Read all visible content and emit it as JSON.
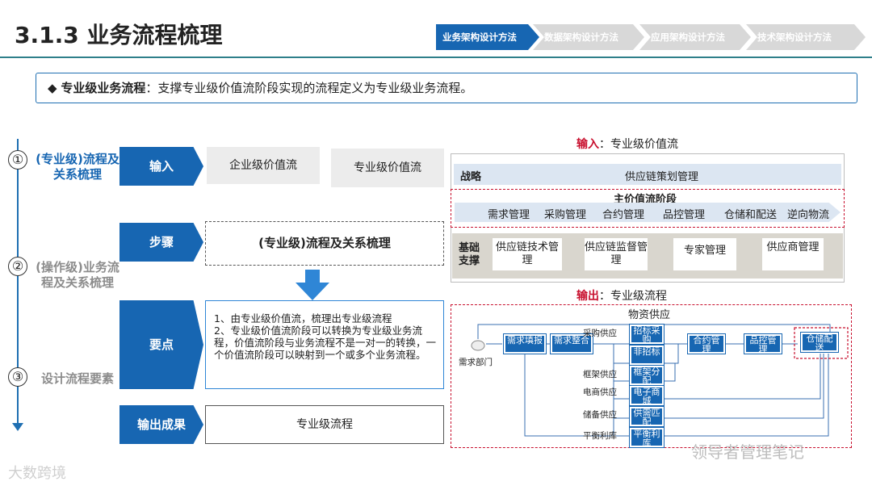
{
  "header": {
    "title": "3.1.3 业务流程梳理",
    "breadcrumbs": [
      "业务架构设计方法",
      "数据架构设计方法",
      "应用架构设计方法",
      "技术架构设计方法"
    ],
    "crumb_colors": [
      "#1766b2",
      "#d8d8d8",
      "#d8d8d8",
      "#d8d8d8"
    ]
  },
  "definition": {
    "bullet": "◆",
    "keyword": "专业级业务流程",
    "text": "：支撑专业级价值流阶段实现的流程定义为专业级业务流程。"
  },
  "timeline": {
    "stages": [
      {
        "num": "①",
        "label": "(专业级)流程及关系梳理"
      },
      {
        "num": "②",
        "label": "(操作级)业务流程及关系梳理"
      },
      {
        "num": "③",
        "label": "设计流程要素"
      }
    ]
  },
  "steps": {
    "input_label": "输入",
    "input_items": [
      "企业级价值流",
      "专业级价值流"
    ],
    "step_label": "步骤",
    "step_value": "(专业级)流程及关系梳理",
    "keypoints_label": "要点",
    "keypoints_text": "1、由专业级价值流，梳理出专业级流程\n2、专业级价值流阶段可以转换为专业级业务流程，价值流阶段与业务流程不是一对一的转换，一个价值流阶段可以映射到一个或多个业务流程。",
    "output_label": "输出成果",
    "output_value": "专业级流程"
  },
  "input_panel": {
    "caption_key": "输入",
    "caption_text": "：专业级价值流",
    "strategy_label": "战略",
    "strategy_value": "供应链策划管理",
    "main_chain_title": "主价值流阶段",
    "main_chain_items": [
      "需求管理",
      "采购管理",
      "合约管理",
      "品控管理",
      "仓储和配送",
      "逆向物流"
    ],
    "support_label": "基础支撑",
    "support_items": [
      "供应链技术管理",
      "供应链监督管理",
      "专家管理",
      "供应商管理"
    ]
  },
  "output_panel": {
    "caption_key": "输出",
    "caption_text": "：专业级流程",
    "title": "物资供应",
    "requester": "需求部门",
    "nodes": [
      "需求填报",
      "需求整合",
      "招标采购",
      "非招标",
      "框架分配",
      "电子商城",
      "供需匹配",
      "平衡利库",
      "合约管理",
      "品控管理",
      "仓储配送"
    ],
    "branch_labels": [
      "采购供应",
      "框架供应",
      "电商供应",
      "储备供应",
      "平衡利库"
    ]
  },
  "watermarks": [
    "大数跨境",
    "领导者管理笔记"
  ],
  "colors": {
    "accent": "#1766b2",
    "highlight": "#c8102e",
    "header_rule": "#2e7f8a"
  }
}
